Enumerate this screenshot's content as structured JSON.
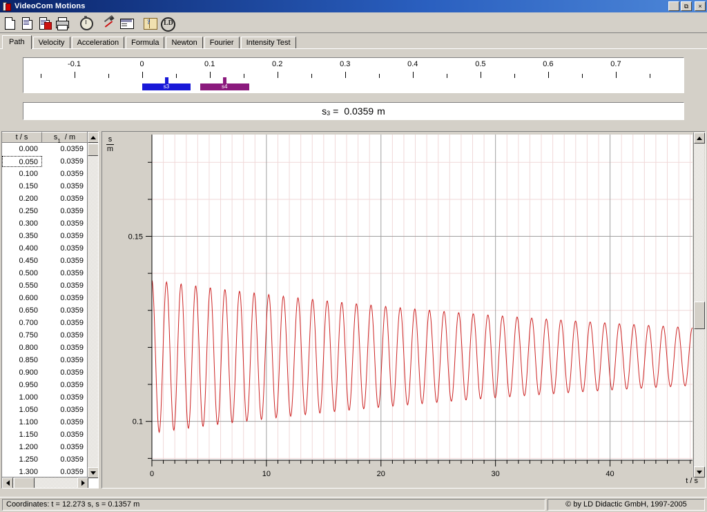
{
  "window": {
    "title": "VideoCom Motions",
    "app_icon": "videocom-icon",
    "controls": [
      {
        "name": "minimize-button",
        "glyph": "_"
      },
      {
        "name": "restore-button",
        "glyph": "❐"
      },
      {
        "name": "close-button",
        "glyph": "×"
      }
    ]
  },
  "toolbar": {
    "buttons": [
      {
        "name": "new-file-button",
        "icon": "new-document-icon",
        "label": "New"
      },
      {
        "name": "open-file-button",
        "icon": "open-document-icon",
        "label": "Open"
      },
      {
        "name": "save-file-button",
        "icon": "save-document-icon",
        "label": "Save"
      },
      {
        "name": "print-button",
        "icon": "printer-icon",
        "label": "Print"
      },
      {
        "name": "timer-button",
        "icon": "stopwatch-icon",
        "label": "Measurement"
      },
      {
        "name": "settings-button",
        "icon": "tools-icon",
        "label": "Settings"
      },
      {
        "name": "display-button",
        "icon": "window-icon",
        "label": "Display"
      },
      {
        "name": "help-button",
        "icon": "help-book-icon",
        "label": "Help"
      },
      {
        "name": "about-button",
        "icon": "ld-logo-icon",
        "label": "About"
      }
    ]
  },
  "tabs": {
    "active": "Path",
    "items": [
      {
        "label": "Path",
        "name": "tab-path"
      },
      {
        "label": "Velocity",
        "name": "tab-velocity"
      },
      {
        "label": "Acceleration",
        "name": "tab-acceleration"
      },
      {
        "label": "Formula",
        "name": "tab-formula"
      },
      {
        "label": "Newton",
        "name": "tab-newton"
      },
      {
        "label": "Fourier",
        "name": "tab-fourier"
      },
      {
        "label": "Intensity Test",
        "name": "tab-intensity-test"
      }
    ]
  },
  "ruler": {
    "min": -0.175,
    "max": 0.8,
    "major_labels": [
      "-0.1",
      "0",
      "0.1",
      "0.2",
      "0.3",
      "0.4",
      "0.5",
      "0.6",
      "0.7"
    ],
    "major_values": [
      -0.1,
      0,
      0.1,
      0.2,
      0.3,
      0.4,
      0.5,
      0.6,
      0.7
    ],
    "minor_values": [
      -0.15,
      -0.05,
      0.05,
      0.15,
      0.25,
      0.35,
      0.45,
      0.55,
      0.65,
      0.75
    ],
    "markers": [
      {
        "name": "marker-s3",
        "label": "s3",
        "color": "#1818d8",
        "start": 0.0,
        "end": 0.072,
        "pointer": 0.0359
      },
      {
        "name": "marker-s4",
        "label": "s4",
        "color": "#8b1a7d",
        "start": 0.086,
        "end": 0.158,
        "pointer": 0.122
      }
    ]
  },
  "value_display": {
    "symbol": "s",
    "subscript": "3",
    "equals": "=",
    "value": "0.0359",
    "unit": "m",
    "full_text": "s3 =  0.0359 m"
  },
  "table": {
    "columns": [
      {
        "name": "column-time",
        "label": "t / s",
        "symbol": "t",
        "unit": "s"
      },
      {
        "name": "column-path",
        "label": "s1 / m",
        "symbol": "s",
        "subscript": "1",
        "unit": "m"
      }
    ],
    "selected_row_index": 1,
    "rows": [
      {
        "t": "0.000",
        "s": "0.0359"
      },
      {
        "t": "0.050",
        "s": "0.0359"
      },
      {
        "t": "0.100",
        "s": "0.0359"
      },
      {
        "t": "0.150",
        "s": "0.0359"
      },
      {
        "t": "0.200",
        "s": "0.0359"
      },
      {
        "t": "0.250",
        "s": "0.0359"
      },
      {
        "t": "0.300",
        "s": "0.0359"
      },
      {
        "t": "0.350",
        "s": "0.0359"
      },
      {
        "t": "0.400",
        "s": "0.0359"
      },
      {
        "t": "0.450",
        "s": "0.0359"
      },
      {
        "t": "0.500",
        "s": "0.0359"
      },
      {
        "t": "0.550",
        "s": "0.0359"
      },
      {
        "t": "0.600",
        "s": "0.0359"
      },
      {
        "t": "0.650",
        "s": "0.0359"
      },
      {
        "t": "0.700",
        "s": "0.0359"
      },
      {
        "t": "0.750",
        "s": "0.0359"
      },
      {
        "t": "0.800",
        "s": "0.0359"
      },
      {
        "t": "0.850",
        "s": "0.0359"
      },
      {
        "t": "0.900",
        "s": "0.0359"
      },
      {
        "t": "0.950",
        "s": "0.0359"
      },
      {
        "t": "1.000",
        "s": "0.0359"
      },
      {
        "t": "1.050",
        "s": "0.0359"
      },
      {
        "t": "1.100",
        "s": "0.0359"
      },
      {
        "t": "1.150",
        "s": "0.0359"
      },
      {
        "t": "1.200",
        "s": "0.0359"
      },
      {
        "t": "1.250",
        "s": "0.0359"
      },
      {
        "t": "1.300",
        "s": "0.0359"
      }
    ]
  },
  "chart_data": {
    "type": "line",
    "title": "",
    "xlabel": "t / s",
    "ylabel": "s / m",
    "ylabel_numerator": "s",
    "ylabel_denominator": "m",
    "xlim": [
      0,
      47.2
    ],
    "ylim": [
      0.0895,
      0.1775
    ],
    "xticks_major": [
      0,
      10,
      20,
      30,
      40
    ],
    "xticks_major_labels": [
      "0",
      "10",
      "20",
      "30",
      "40"
    ],
    "xtick_minor_step": 1,
    "yticks_major": [
      0.1,
      0.15
    ],
    "yticks_major_labels": [
      "0.1",
      "0.15"
    ],
    "ytick_minor_step": 0.01,
    "grid": true,
    "grid_major_color": "#a0a0a0",
    "grid_minor_color": "#f0d8d8",
    "legend": "none",
    "series": [
      {
        "name": "s1",
        "color": "#cc2222",
        "description": "damped harmonic oscillation",
        "model": "offset + amplitude * exp(-t/tau) * cos(2*pi*t/period + phase)",
        "offset": 0.1175,
        "amplitude_initial": 0.0207,
        "amplitude_final": 0.0078,
        "decay_tau": 48.0,
        "period": 1.2755,
        "phase_deg": 0,
        "t_start": 0.0,
        "t_end": 47.2,
        "samples": 1180
      }
    ]
  },
  "status_bar": {
    "coordinates_label": "Coordinates:",
    "coordinates_text": "Coordinates:  t = 12.273 s,   s = 0.1357 m",
    "t_value": "12.273",
    "t_unit": "s",
    "s_value": "0.1357",
    "s_unit": "m",
    "copyright": "© by LD Didactic GmbH, 1997-2005"
  }
}
